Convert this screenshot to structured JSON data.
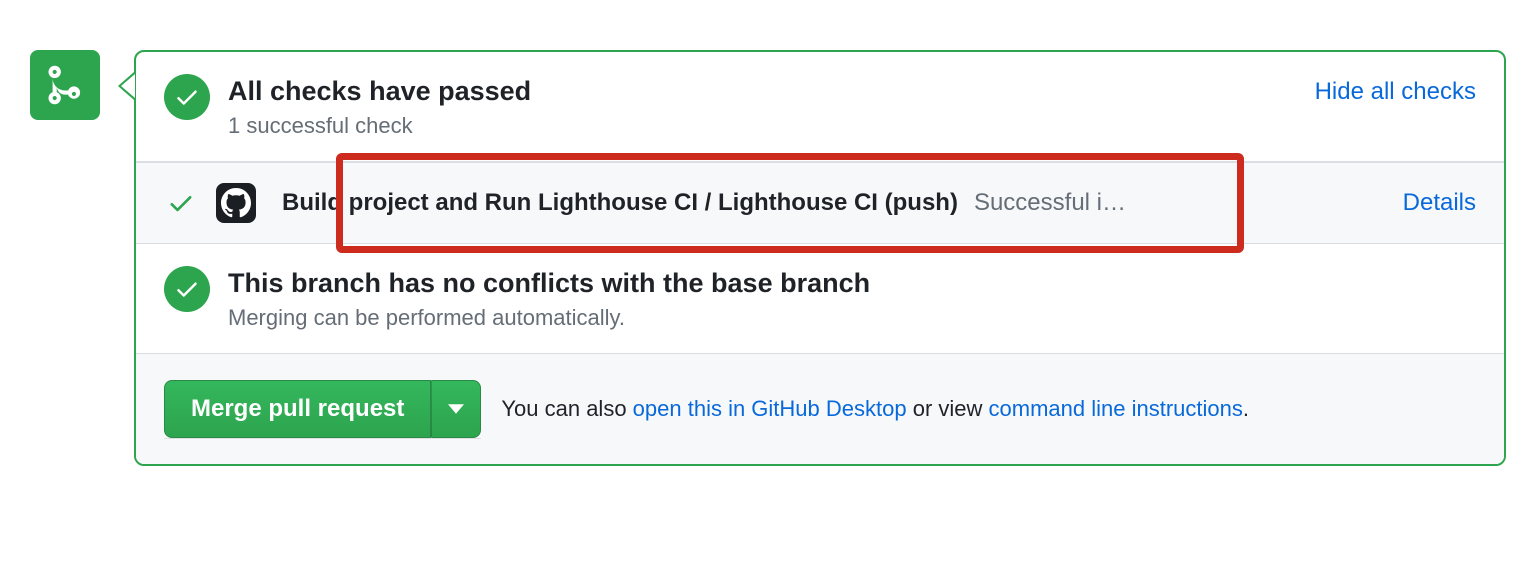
{
  "checks": {
    "title": "All checks have passed",
    "subtitle": "1 successful check",
    "hide_link": "Hide all checks",
    "items": [
      {
        "name": "Build project and Run Lighthouse CI / Lighthouse CI (push)",
        "status": "Successful i…",
        "details_label": "Details"
      }
    ]
  },
  "conflicts": {
    "title": "This branch has no conflicts with the base branch",
    "subtitle": "Merging can be performed automatically."
  },
  "merge": {
    "button_label": "Merge pull request",
    "prefix_text": "You can also ",
    "desktop_link": "open this in GitHub Desktop",
    "middle_text": " or view ",
    "cli_link": "command line instructions",
    "suffix_text": "."
  }
}
